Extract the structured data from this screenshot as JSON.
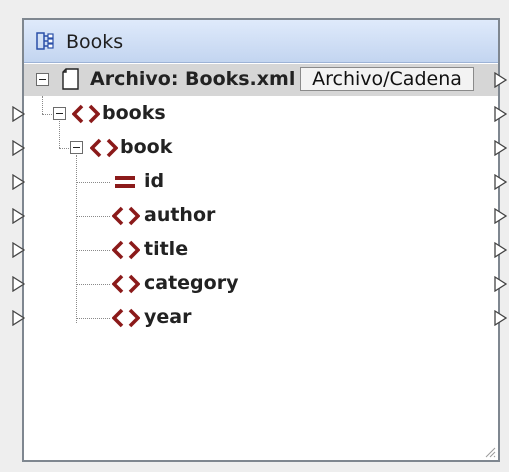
{
  "component": {
    "title": "Books",
    "title_icon": "component-icon"
  },
  "file_row": {
    "label": "Archivo: Books.xml",
    "button": "Archivo/Cadena",
    "icon": "document-icon"
  },
  "tree": [
    {
      "label": "books",
      "type": "element",
      "icon": "element-icon"
    },
    {
      "label": "book",
      "type": "element",
      "icon": "element-icon"
    },
    {
      "label": "id",
      "type": "attribute",
      "icon": "attribute-icon"
    },
    {
      "label": "author",
      "type": "element",
      "icon": "element-icon"
    },
    {
      "label": "title",
      "type": "element",
      "icon": "element-icon"
    },
    {
      "label": "category",
      "type": "element",
      "icon": "element-icon"
    },
    {
      "label": "year",
      "type": "element",
      "icon": "element-icon"
    }
  ],
  "colors": {
    "element_icon": "#8b1a1a",
    "titlebar_top": "#dfeafb",
    "titlebar_bottom": "#c3d5f0",
    "file_row_bg": "#d6d6d6"
  }
}
